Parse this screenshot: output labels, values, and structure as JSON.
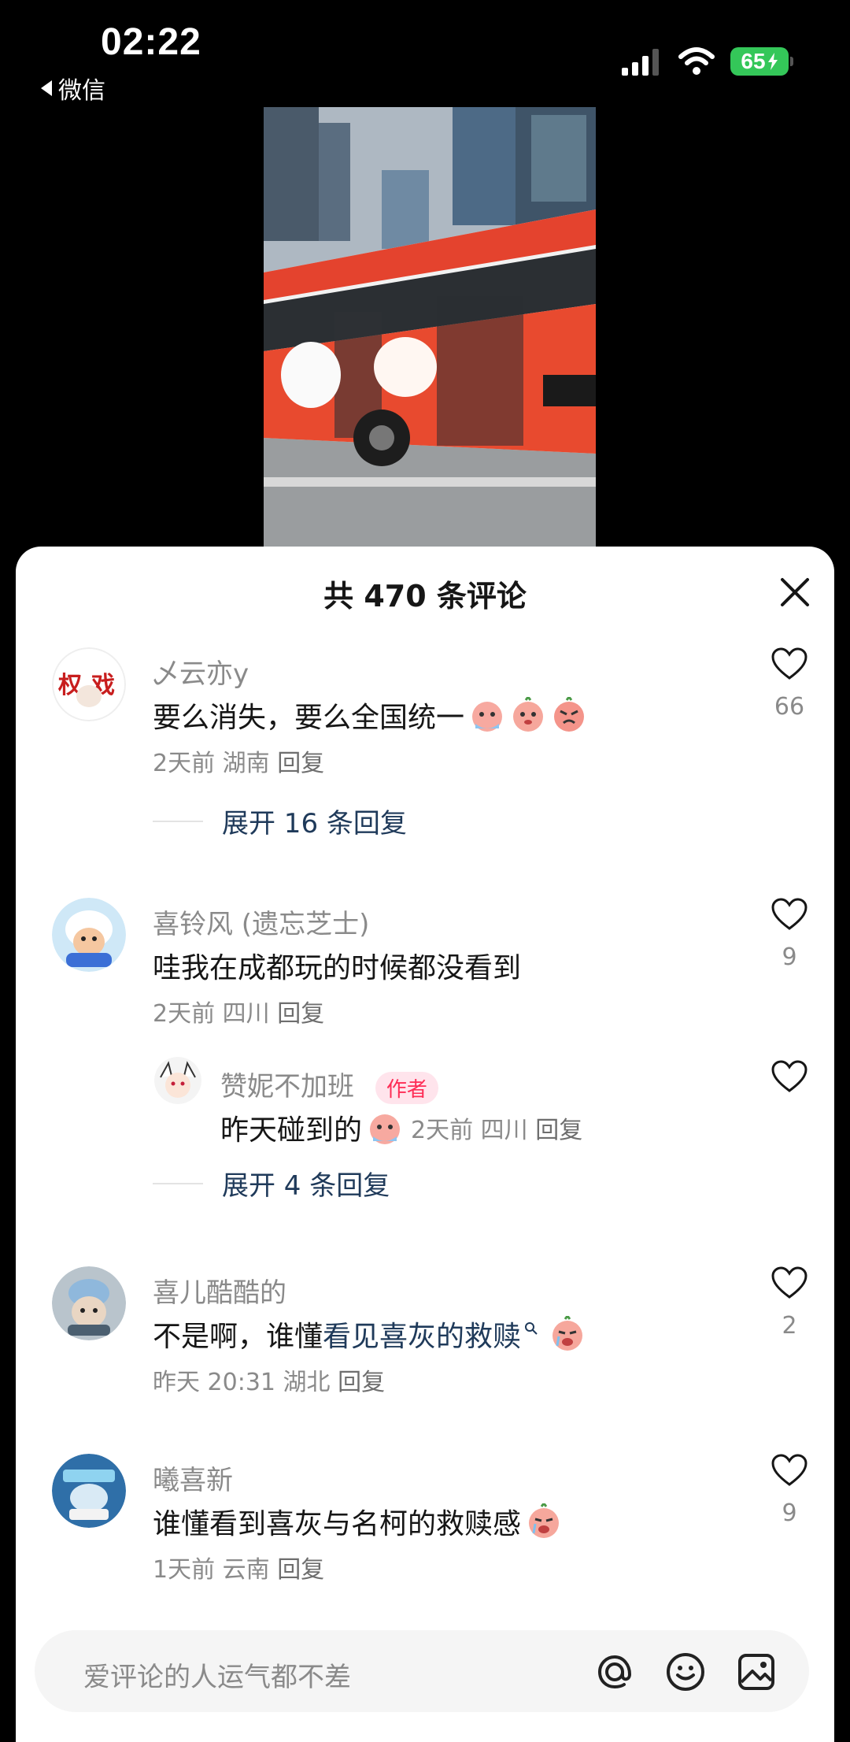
{
  "status_bar": {
    "time": "02:22",
    "back_app": "微信",
    "battery": "65"
  },
  "sheet": {
    "title": "共 470 条评论"
  },
  "comments": [
    {
      "author": "乄云亦y",
      "text": "要么消失，要么全国统一",
      "time": "2天前",
      "location": "湖南",
      "reply": "回复",
      "likes": "66",
      "expand": "展开 16 条回复"
    },
    {
      "author": "喜铃风 (遗忘芝士)",
      "text": "哇我在成都玩的时候都没看到",
      "time": "2天前",
      "location": "四川",
      "reply": "回复",
      "likes": "9",
      "sub_reply": {
        "author": "赞妮不加班",
        "badge": "作者",
        "text": "昨天碰到的",
        "time": "2天前",
        "location": "四川",
        "reply": "回复"
      },
      "expand": "展开 4 条回复"
    },
    {
      "author": "喜儿酷酷的",
      "text_prefix": "不是啊，谁懂 ",
      "text_link": "看见喜灰的救赎",
      "time": "昨天 20:31",
      "location": "湖北",
      "reply": "回复",
      "likes": "2"
    },
    {
      "author": "曦喜新",
      "text": "谁懂看到喜灰与名柯的救赎感",
      "time": "1天前",
      "location": "云南",
      "reply": "回复",
      "likes": "9"
    }
  ],
  "input": {
    "placeholder": "爱评论的人运气都不差"
  },
  "icons": {
    "like": "heart-outline-icon",
    "close": "close-icon",
    "mention": "at-icon",
    "emoji": "smiley-icon",
    "image": "image-icon"
  },
  "colors": {
    "link": "#1f3a5a",
    "author_badge": "#fe2c55",
    "battery": "#34c759"
  }
}
